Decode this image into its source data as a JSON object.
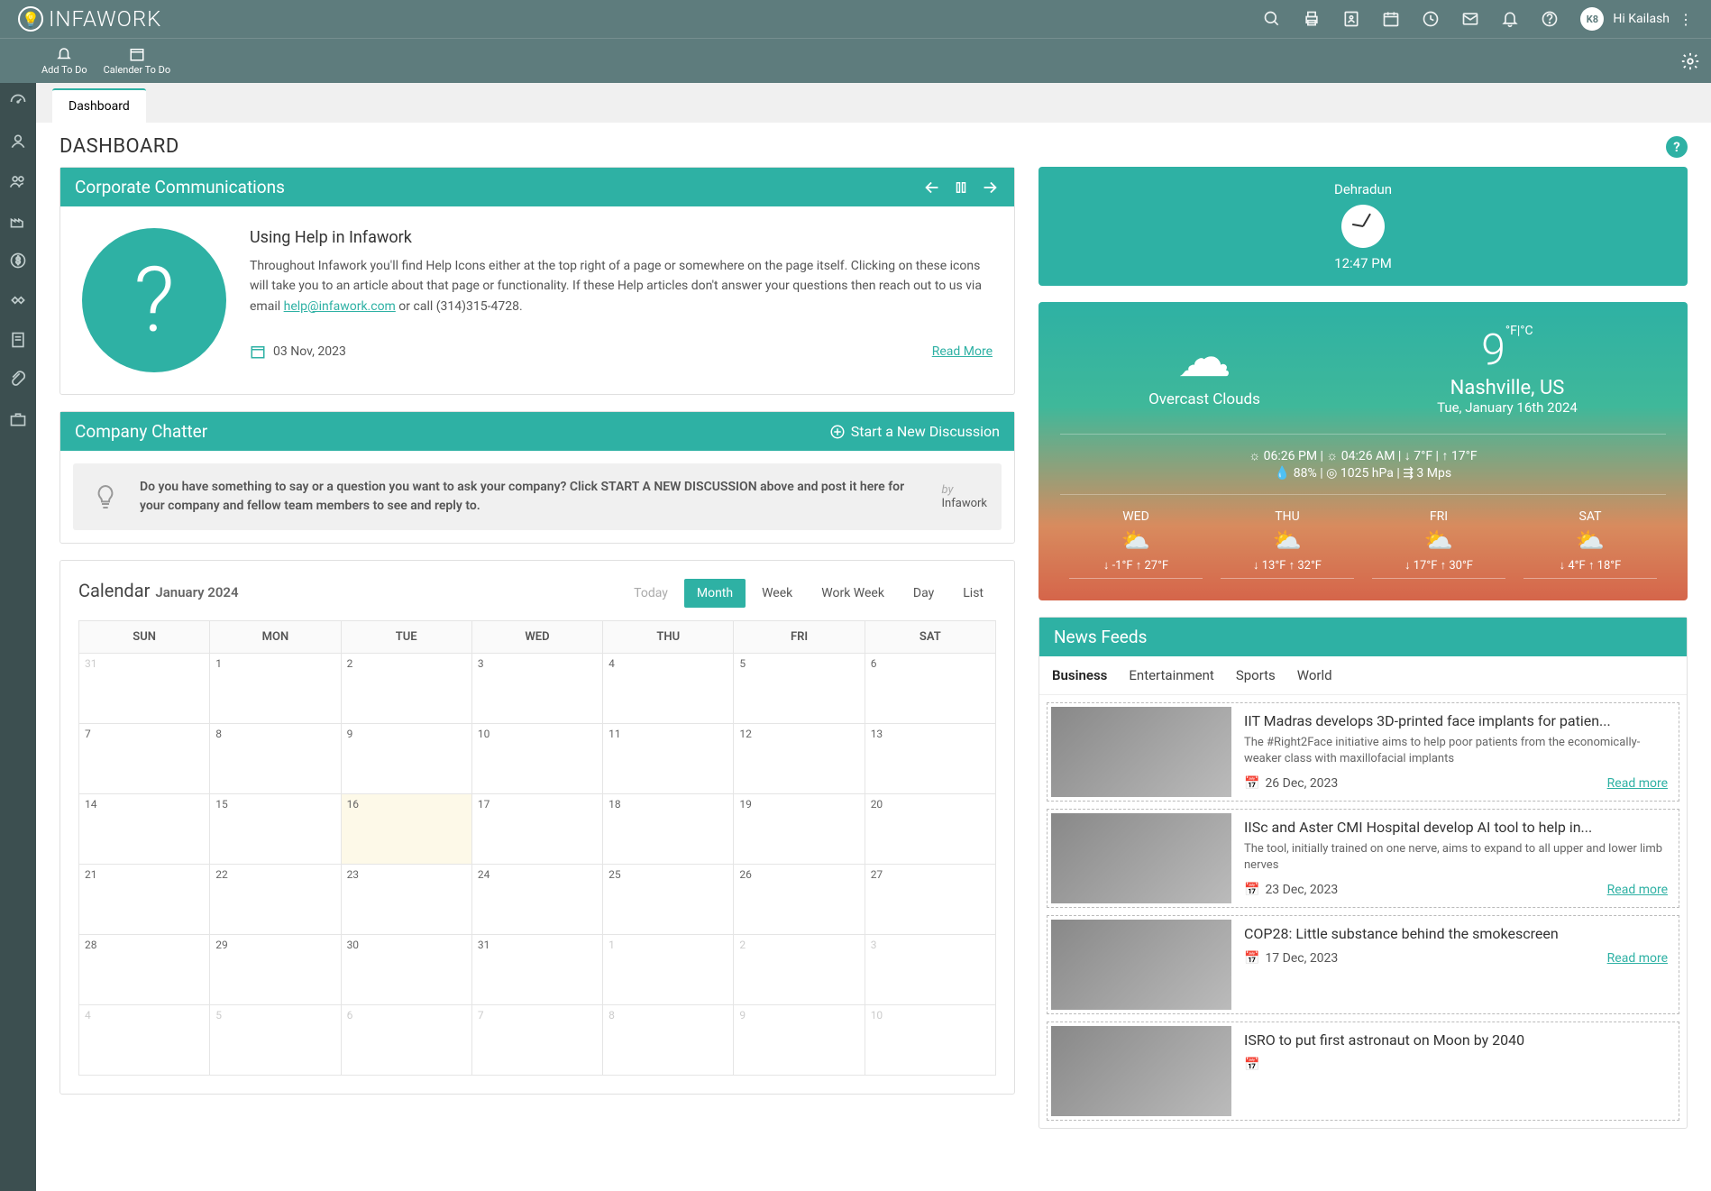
{
  "brand": "INFAWORK",
  "user": {
    "initials": "K8",
    "greeting": "Hi Kailash"
  },
  "subheader": [
    {
      "label": "Add To Do"
    },
    {
      "label": "Calender To Do"
    }
  ],
  "tab": "Dashboard",
  "page_title": "DASHBOARD",
  "corp_comm": {
    "header": "Corporate Communications",
    "title": "Using Help in Infawork",
    "body_pre": "Throughout Infawork you'll find Help Icons either at the top right of a page or somewhere on the page itself. Clicking on these icons will take you to an article about that page or functionality. If these Help articles don't answer your questions then reach out to us via email ",
    "email": "help@infawork.com",
    "body_post": " or call (314)315-4728.",
    "date": "03 Nov, 2023",
    "read_more": "Read More"
  },
  "chatter": {
    "header": "Company Chatter",
    "start_label": "Start a New Discussion",
    "prompt": "Do you have something to say or a question you want to ask your company? Click START A NEW DISCUSSION above and post it here for your company and fellow team members to see and reply to.",
    "by_label": "by",
    "by": "Infawork"
  },
  "calendar": {
    "title": "Calendar",
    "month_label": "January 2024",
    "views": [
      "Today",
      "Month",
      "Week",
      "Work Week",
      "Day",
      "List"
    ],
    "active_view": "Month",
    "days": [
      "SUN",
      "MON",
      "TUE",
      "WED",
      "THU",
      "FRI",
      "SAT"
    ],
    "rows": [
      [
        {
          "n": "31",
          "o": true
        },
        {
          "n": "1"
        },
        {
          "n": "2"
        },
        {
          "n": "3"
        },
        {
          "n": "4"
        },
        {
          "n": "5"
        },
        {
          "n": "6"
        }
      ],
      [
        {
          "n": "7"
        },
        {
          "n": "8"
        },
        {
          "n": "9"
        },
        {
          "n": "10"
        },
        {
          "n": "11"
        },
        {
          "n": "12"
        },
        {
          "n": "13"
        }
      ],
      [
        {
          "n": "14"
        },
        {
          "n": "15"
        },
        {
          "n": "16",
          "t": true
        },
        {
          "n": "17"
        },
        {
          "n": "18"
        },
        {
          "n": "19"
        },
        {
          "n": "20"
        }
      ],
      [
        {
          "n": "21"
        },
        {
          "n": "22"
        },
        {
          "n": "23"
        },
        {
          "n": "24"
        },
        {
          "n": "25"
        },
        {
          "n": "26"
        },
        {
          "n": "27"
        }
      ],
      [
        {
          "n": "28"
        },
        {
          "n": "29"
        },
        {
          "n": "30"
        },
        {
          "n": "31"
        },
        {
          "n": "1",
          "o": true
        },
        {
          "n": "2",
          "o": true
        },
        {
          "n": "3",
          "o": true
        }
      ],
      [
        {
          "n": "4",
          "o": true
        },
        {
          "n": "5",
          "o": true
        },
        {
          "n": "6",
          "o": true
        },
        {
          "n": "7",
          "o": true
        },
        {
          "n": "8",
          "o": true
        },
        {
          "n": "9",
          "o": true
        },
        {
          "n": "10",
          "o": true
        }
      ]
    ]
  },
  "clock": {
    "city": "Dehradun",
    "time": "12:47 PM"
  },
  "weather": {
    "desc": "Overcast Clouds",
    "temp": "9",
    "unit": "°F|°C",
    "location": "Nashville, US",
    "date": "Tue, January 16th 2024",
    "stats1": "☼ 06:26 PM  |  ☼ 04:26 AM  |  ↓ 7°F  |  ↑ 17°F",
    "stats2": "💧 88%  |  ◎ 1025 hPa  |  ⇶ 3 Mps",
    "forecast": [
      {
        "d": "WED",
        "lo": "-1°F",
        "hi": "27°F"
      },
      {
        "d": "THU",
        "lo": "13°F",
        "hi": "32°F"
      },
      {
        "d": "FRI",
        "lo": "17°F",
        "hi": "30°F"
      },
      {
        "d": "SAT",
        "lo": "4°F",
        "hi": "18°F"
      }
    ]
  },
  "news": {
    "header": "News Feeds",
    "tabs": [
      "Business",
      "Entertainment",
      "Sports",
      "World"
    ],
    "active": "Business",
    "items": [
      {
        "title": "IIT Madras develops 3D-printed face implants for patien...",
        "desc": "The #Right2Face initiative aims to help poor patients from the economically-weaker class with maxillofacial implants",
        "date": "26 Dec, 2023",
        "read": "Read more"
      },
      {
        "title": "IISc and Aster CMI Hospital develop AI tool to help in...",
        "desc": "The tool, initially trained on one nerve, aims to expand to all upper and lower limb nerves",
        "date": "23 Dec, 2023",
        "read": "Read more"
      },
      {
        "title": "COP28: Little substance behind the smokescreen",
        "desc": "",
        "date": "17 Dec, 2023",
        "read": "Read more"
      },
      {
        "title": "ISRO to put first astronaut on Moon by 2040",
        "desc": "",
        "date": "",
        "read": ""
      }
    ]
  }
}
